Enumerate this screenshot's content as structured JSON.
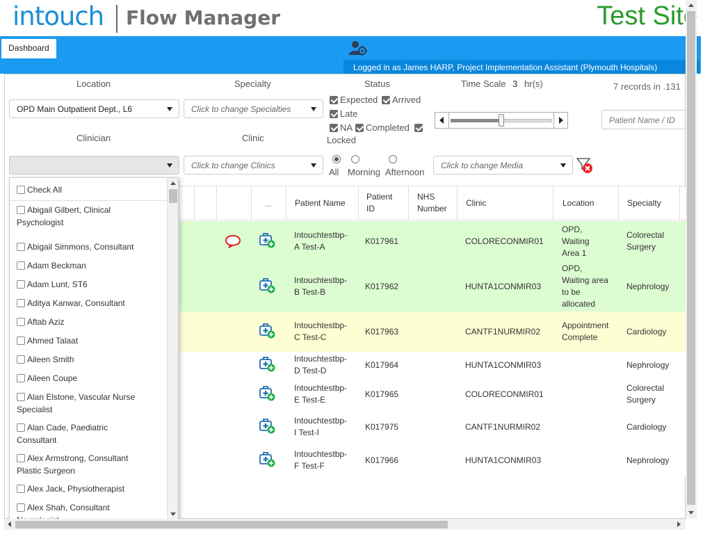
{
  "header": {
    "logo_intouch": "intouch",
    "logo_product": "Flow Manager",
    "site_label": "Test Site"
  },
  "nav": {
    "tabs": [
      {
        "label": "Dashboard"
      }
    ],
    "user_icon": "user-settings-icon",
    "logged_in": "Logged in as James HARP, Project Implementation Assistant (Plymouth Hospitals)"
  },
  "filters": {
    "location": {
      "label": "Location",
      "value": "OPD Main Outpatient Dept., L6"
    },
    "specialty": {
      "label": "Specialty",
      "placeholder": "Click to change Specialties"
    },
    "status": {
      "label": "Status",
      "options": [
        {
          "label": "Expected",
          "checked": true
        },
        {
          "label": "Arrived",
          "checked": true
        },
        {
          "label": "Late",
          "checked": true
        },
        {
          "label": "NA",
          "checked": true
        },
        {
          "label": "Completed",
          "checked": true
        },
        {
          "label": "Locked",
          "checked": true
        }
      ]
    },
    "time_scale": {
      "label": "Time Scale",
      "value": "3",
      "unit": "hr(s)",
      "slider_level": 0.5
    },
    "records": "7 records in .131",
    "patient_search": {
      "placeholder": "Patient Name / ID"
    },
    "clinician": {
      "label": "Clinician",
      "value": ""
    },
    "clinic": {
      "label": "Clinic",
      "placeholder": "Click to change Clinics"
    },
    "time_of_day": [
      {
        "label": "All",
        "selected": true
      },
      {
        "label": "Morning",
        "selected": false
      },
      {
        "label": "Afternoon",
        "selected": false
      }
    ],
    "media": {
      "placeholder": "Click to change Media"
    },
    "clear_filter_icon": "filter-clear-icon"
  },
  "clinician_dropdown": {
    "check_all": "Check All",
    "items": [
      [
        "Abigail Gilbert, Clinical",
        "Psychologist"
      ],
      [
        "Abigail Simmons, Consultant"
      ],
      [
        "Adam Beckman"
      ],
      [
        "Adam Lunt, ST6"
      ],
      [
        "Aditya Kanwar, Consultant"
      ],
      [
        "Aftab Aziz"
      ],
      [
        "Ahmed Talaat"
      ],
      [
        "Aileen Smith"
      ],
      [
        "Aileen Coupe"
      ],
      [
        "Alan Elstone, Vascular Nurse",
        "Specialist"
      ],
      [
        "Alan Cade, Paediatric",
        "Consultant"
      ],
      [
        "Alex Armstrong, Consultant",
        "Plastic Surgeon"
      ],
      [
        "Alex Jack, Physiotherapist"
      ],
      [
        "Alex Shah, Consultant",
        "Neurologist"
      ]
    ]
  },
  "table": {
    "columns": {
      "actions": "...",
      "patient_name": "Patient Name",
      "patient_id": [
        "Patient",
        "ID"
      ],
      "nhs_number": [
        "NHS",
        "Number"
      ],
      "clinic": "Clinic",
      "location": "Location",
      "specialty": "Specialty"
    },
    "rows": [
      {
        "name": [
          "Intouchtestbp-",
          "A Test-A"
        ],
        "id": "K017961",
        "nhs": "",
        "clinic": "COLORECONMIR01",
        "location": [
          "OPD,",
          "Waiting",
          "Area 1"
        ],
        "specialty": [
          "Colorectal",
          "Surgery"
        ],
        "status_color": "#dcfcd2",
        "has_message": true
      },
      {
        "name": [
          "Intouchtestbp-",
          "B Test-B"
        ],
        "id": "K017962",
        "nhs": "",
        "clinic": "HUNTA1CONMIR03",
        "location": [
          "OPD,",
          "Waiting area",
          "to be",
          "allocated"
        ],
        "specialty": [
          "Nephrology"
        ],
        "status_color": "#dcfcd2",
        "has_message": false
      },
      {
        "name": [
          "Intouchtestbp-",
          "C Test-C"
        ],
        "id": "K017963",
        "nhs": "",
        "clinic": "CANTF1NURMIR02",
        "location": [
          "Appointment",
          "Complete"
        ],
        "specialty": [
          "Cardiology"
        ],
        "status_color": "#fefed4",
        "has_message": false
      },
      {
        "name": [
          "Intouchtestbp-",
          "D Test-D"
        ],
        "id": "K017964",
        "nhs": "",
        "clinic": "HUNTA1CONMIR03",
        "location": [],
        "specialty": [
          "Nephrology"
        ],
        "status_color": "#ffffff",
        "has_message": false
      },
      {
        "name": [
          "Intouchtestbp-",
          "E Test-E"
        ],
        "id": "K017965",
        "nhs": "",
        "clinic": "COLORECONMIR01",
        "location": [],
        "specialty": [
          "Colorectal",
          "Surgery"
        ],
        "status_color": "#ffffff",
        "has_message": false
      },
      {
        "name": [
          "Intouchtestbp-",
          "I Test-I"
        ],
        "id": "K017975",
        "nhs": "",
        "clinic": "CANTF1NURMIR02",
        "location": [],
        "specialty": [
          "Cardiology"
        ],
        "status_color": "#ffffff",
        "has_message": false
      },
      {
        "name": [
          "Intouchtestbp-",
          "F Test-F"
        ],
        "id": "K017966",
        "nhs": "",
        "clinic": "HUNTA1CONMIR03",
        "location": [],
        "specialty": [
          "Nephrology"
        ],
        "status_color": "#ffffff",
        "has_message": false
      }
    ]
  },
  "colors": {
    "brand_blue": "#1a9af0",
    "test_site_green": "#2a9a2a",
    "row_arrived": "#dcfcd2",
    "row_complete": "#fefed4"
  }
}
